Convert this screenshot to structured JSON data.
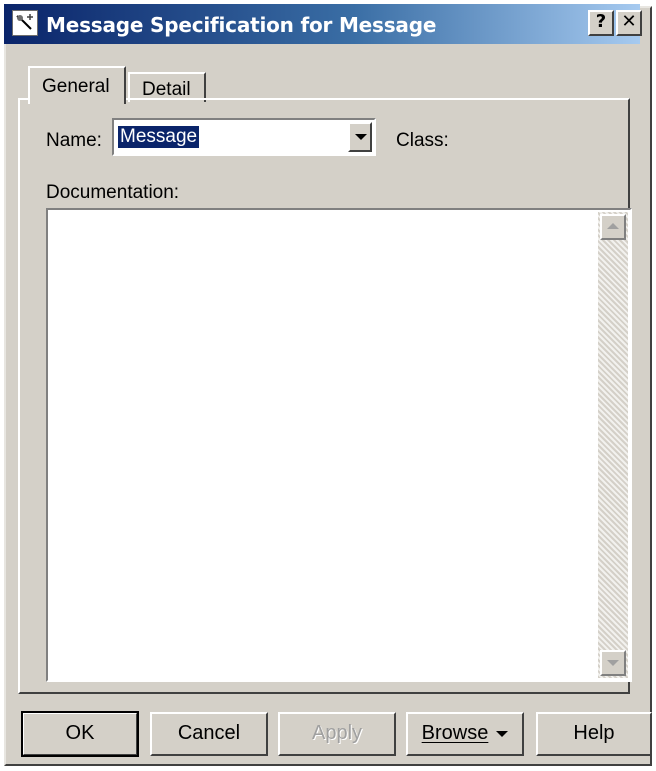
{
  "window": {
    "title": "Message Specification for Message",
    "help_button": "?",
    "close_button": "✕"
  },
  "tabs": [
    {
      "label": "General",
      "active": true
    },
    {
      "label": "Detail",
      "active": false
    }
  ],
  "general": {
    "name_label": "Name:",
    "name_value": "Message",
    "class_label": "Class:",
    "documentation_label": "Documentation:",
    "documentation_value": ""
  },
  "buttons": {
    "ok": "OK",
    "cancel": "Cancel",
    "apply": "Apply",
    "browse": "Browse",
    "help": "Help"
  },
  "colors": {
    "titlebar_start": "#0a246a",
    "titlebar_end": "#a6caf0",
    "face": "#d4d0c8",
    "selection": "#0a246a"
  },
  "icons": [
    "dialog-app-icon",
    "chevron-down-icon",
    "scroll-up-icon",
    "scroll-down-icon"
  ]
}
